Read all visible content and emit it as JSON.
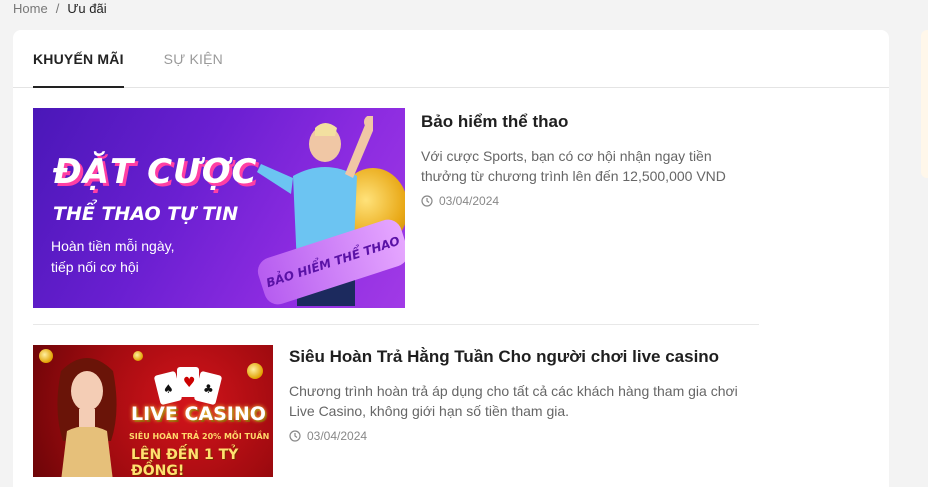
{
  "breadcrumb": {
    "home": "Home",
    "separator": "/",
    "current": "Ưu đãi"
  },
  "tabs": [
    {
      "label": "KHUYẾN MÃI",
      "active": true
    },
    {
      "label": "SỰ KIỆN",
      "active": false
    }
  ],
  "promos": [
    {
      "title": "Bảo hiểm thể thao",
      "description": "Với cược Sports, bạn có cơ hội nhận ngay tiền thưởng từ chương trình lên đến 12,500,000 VND",
      "date": "03/04/2024",
      "banner": {
        "line1": "ĐẶT CƯỢC",
        "line2": "THỂ THAO TỰ TIN",
        "line3": "Hoàn tiền mỗi ngày,",
        "line4": "tiếp nối cơ hội",
        "ribbon": "BẢO HIỂM THỂ THAO"
      }
    },
    {
      "title": "Siêu Hoàn Trả Hằng Tuần Cho người chơi live casino",
      "description": "Chương trình hoàn trả áp dụng cho tất cả các khách hàng tham gia chơi Live Casino, không giới hạn số tiền tham gia.",
      "date": "03/04/2024",
      "banner": {
        "line1": "LIVE CASINO",
        "line2": "SIÊU HOÀN TRẢ 20% MỖI TUẦN",
        "line3": "LÊN ĐẾN 1 TỶ ĐỒNG!"
      }
    }
  ],
  "icons": {
    "date": "clock-icon"
  },
  "colors": {
    "accent": "#222222",
    "banner1": "#6a1fd1",
    "banner2": "#c4121a"
  }
}
